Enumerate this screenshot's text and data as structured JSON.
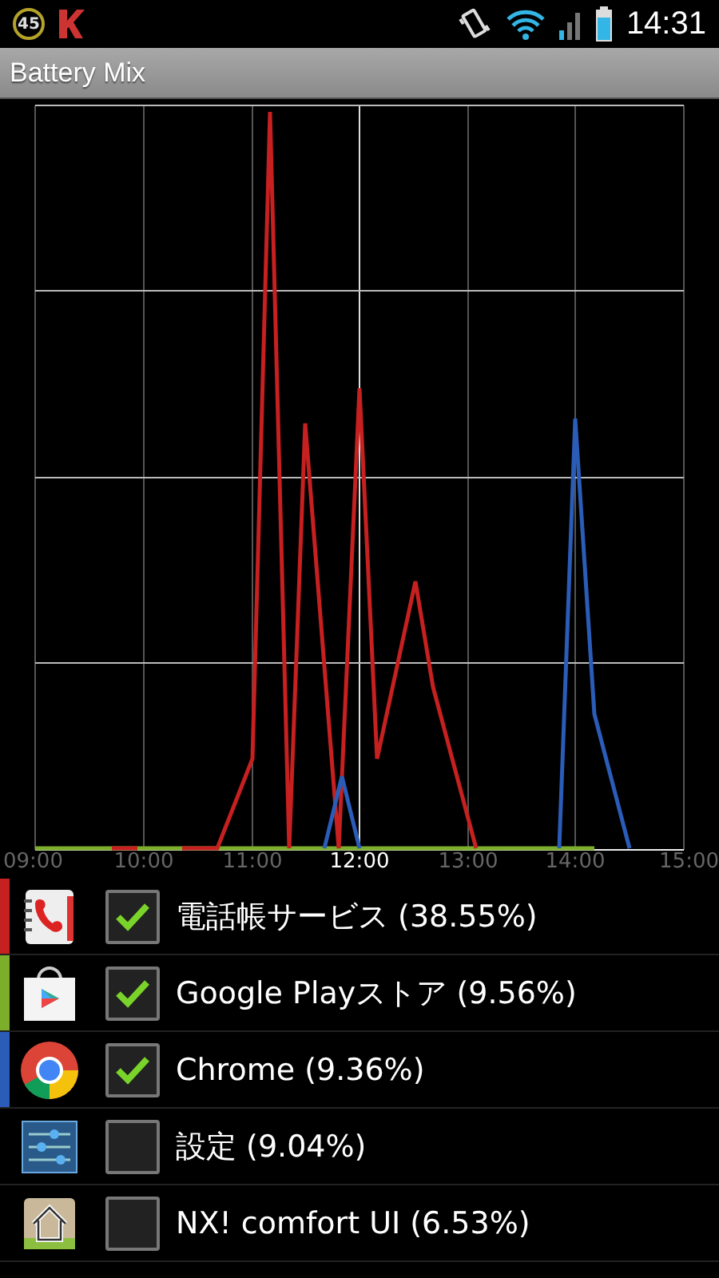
{
  "status_bar": {
    "badge": "45",
    "time": "14:31"
  },
  "title": "Battery Mix",
  "chart": {
    "x_labels": [
      {
        "label": "09:00",
        "highlighted": false
      },
      {
        "label": "10:00",
        "highlighted": false
      },
      {
        "label": "11:00",
        "highlighted": false
      },
      {
        "label": "12:00",
        "highlighted": true
      },
      {
        "label": "13:00",
        "highlighted": false
      },
      {
        "label": "14:00",
        "highlighted": false
      },
      {
        "label": "15:00",
        "highlighted": false
      }
    ]
  },
  "apps": [
    {
      "kind": "contacts",
      "name": "電話帳サービス (38.55%)",
      "color": "#c62020",
      "checked": true
    },
    {
      "kind": "store",
      "name": "Google Playストア (9.56%)",
      "color": "#7cae2c",
      "checked": true
    },
    {
      "kind": "browser",
      "name": "Chrome (9.36%)",
      "color": "#2a5cb8",
      "checked": true
    },
    {
      "kind": "settings",
      "name": "設定 (9.04%)",
      "checked": false
    },
    {
      "kind": "home",
      "name": "NX! comfort UI (6.53%)",
      "checked": false
    }
  ]
}
